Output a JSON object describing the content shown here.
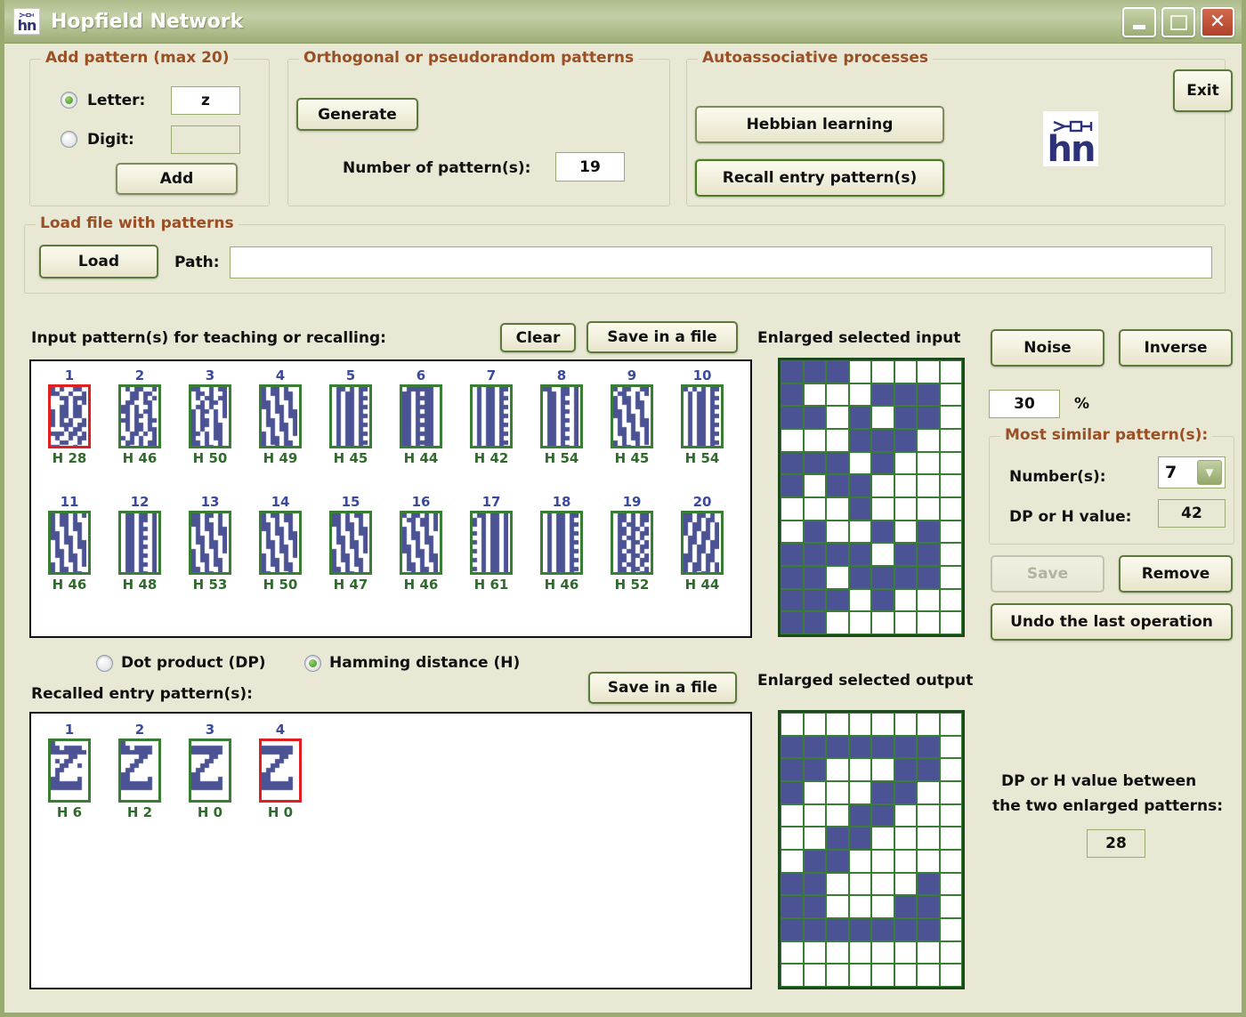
{
  "window": {
    "title": "Hopfield Network",
    "icon": "hn-app-icon",
    "buttons": {
      "minimize": "minimize-button",
      "maximize": "maximize-button",
      "close": "close-button"
    }
  },
  "add_pattern": {
    "legend": "Add pattern (max 20)",
    "letter_label": "Letter:",
    "letter_value": "z",
    "letter_selected": true,
    "digit_label": "Digit:",
    "digit_value": "",
    "digit_selected": false,
    "add_label": "Add"
  },
  "orthogonal": {
    "legend": "Orthogonal or pseudorandom patterns",
    "generate_label": "Generate",
    "number_label": "Number of pattern(s):",
    "number_value": "19"
  },
  "autoassociative": {
    "legend": "Autoassociative processes",
    "hebbian_label": "Hebbian learning",
    "recall_label": "Recall entry pattern(s)"
  },
  "exit_label": "Exit",
  "load_file": {
    "legend": "Load file with patterns",
    "load_label": "Load",
    "path_label": "Path:",
    "path_value": ""
  },
  "input_section": {
    "title": "Input pattern(s) for teaching or recalling:",
    "clear_label": "Clear",
    "save_label": "Save in a file",
    "enlarged_label": "Enlarged selected input"
  },
  "right_controls": {
    "noise_label": "Noise",
    "inverse_label": "Inverse",
    "noise_value": "30",
    "percent_label": "%",
    "similar_legend": "Most similar pattern(s):",
    "numbers_label": "Number(s):",
    "numbers_value": "7",
    "dph_label": "DP or H value:",
    "dph_value": "42",
    "save_label": "Save",
    "save_disabled": true,
    "remove_label": "Remove",
    "undo_label": "Undo the last operation"
  },
  "metric": {
    "dot_product_label": "Dot product (DP)",
    "dot_product_selected": false,
    "hamming_label": "Hamming distance (H)",
    "hamming_selected": true
  },
  "recalled_section": {
    "title": "Recalled entry pattern(s):",
    "save_label": "Save in a file",
    "enlarged_label": "Enlarged selected output"
  },
  "dph_between": {
    "line1": "DP or H value between",
    "line2": "the two enlarged patterns:",
    "value": "28"
  },
  "colors": {
    "pattern_blue": "#4b5394",
    "border_green": "#3a7d34",
    "border_selected": "#e02020",
    "legend_brown": "#9b4f24",
    "index_blue": "#3b4a9c",
    "hvalue_green": "#2f6b2c",
    "window_bg": "#e9e8d5",
    "titlebar_green": "#aebc8c"
  },
  "input_patterns": [
    {
      "index": "1",
      "h": "H 28",
      "selected": true,
      "bits": "101001101100100100110111000101010011011010110110101101101010100110111011000101101110110101001011001100101100010011011001101010001000"
    },
    {
      "index": "2",
      "h": "H 46",
      "selected": false,
      "bits": "010110010011011000110101011001101101001011010110010110101101001101011010010110110011010110101001011010110100101101011010011010110101"
    },
    {
      "index": "3",
      "h": "H 50",
      "selected": false,
      "bits": "110010110110100101011011001011010110100110110101101001011011010010110110101001101101011010010110110100101101101001011011010010110101"
    },
    {
      "index": "4",
      "h": "H 49",
      "selected": false,
      "bits": "101101001011011010010110110100101101101001011011010010110110100101101101001011011010010110110100101101101001011011010010110110100101"
    },
    {
      "index": "5",
      "h": "H 45",
      "selected": false,
      "bits": "011010110101101001011011010110100101101101011010010110110101101001011011010110100101101101011010010110110101101001011011010110100101"
    },
    {
      "index": "6",
      "h": "H 44",
      "selected": false,
      "bits": "011111101101011011011110110101101101111011010110110111101101011011011110110101101101111011010110110111101101011011011110110101101101"
    },
    {
      "index": "7",
      "h": "H 42",
      "selected": false,
      "bits": "010110110101101001011011010110100101101101011010010110110101101001011011010110100101101101011010010110110101101001011011010110100101"
    },
    {
      "index": "8",
      "h": "H 54",
      "selected": false,
      "bits": "110011010110110101101001011011010110100101101101011010010110110101101001011011010110100101101101011010010110110101101001011011010110"
    },
    {
      "index": "9",
      "h": "H 45",
      "selected": false,
      "bits": "101100110110010110110100101101101001011011010010110110100101101101001011011010010110110100101101101001011011010010110110100101101101"
    },
    {
      "index": "10",
      "h": "H 54",
      "selected": false,
      "bits": "101010110101101001011011010110100101101101011010010110110101101001011011010110100101101101011010010110110101101001011011010110100101"
    },
    {
      "index": "11",
      "h": "H 46",
      "selected": false,
      "bits": "101101011011010010110110100101101101001011011010010110110100101101101001011011010010110110100101101101001011011010010110110100101101"
    },
    {
      "index": "12",
      "h": "H 48",
      "selected": false,
      "bits": "011011010110110101101001011011010110100101101101011010010110110101101001011011010110100101101101011010010110110101101001011011010110"
    },
    {
      "index": "13",
      "h": "H 53",
      "selected": false,
      "bits": "110110101101001011011010010110110100101101101001011011010010110110100101101101001011011010010110110100101101101001011011010010110110"
    },
    {
      "index": "14",
      "h": "H 50",
      "selected": false,
      "bits": "101101101001011011010010110110100101101101001011011010010110110100101101101001011011010010110110100101101101001011011010010110110100"
    },
    {
      "index": "15",
      "h": "H 47",
      "selected": false,
      "bits": "110101101101001011011010010110110100101101101001011011010010110110100101101101001011011010010110110100101101101001011011010010110110"
    },
    {
      "index": "16",
      "h": "H 46",
      "selected": false,
      "bits": "101101010110110100101101101001011011010010110110100101101101001011011010010110110100101101101001011011010010110110100101101101001011"
    },
    {
      "index": "17",
      "h": "H 61",
      "selected": false,
      "bits": "011011011010110110101101001011011010110100101101101011010010110110101101001011011010110100101101101011010010110110101101001011011010"
    },
    {
      "index": "18",
      "h": "H 46",
      "selected": false,
      "bits": "010110110101101001011011010110100101101101011010010110110101101001011011010110100101101101011010010110110101101001011011010110100101"
    },
    {
      "index": "19",
      "h": "H 52",
      "selected": false,
      "bits": "011010110110101101011010011011010110101101011010011011010110101101011010011011010110101101011010011011010110101101011010011011010110"
    },
    {
      "index": "20",
      "h": "H 44",
      "selected": false,
      "bits": "110110101101011010110101101101011010110101101101011010110101101101011010110101101101011010110101101101011010110101101101011010110101"
    }
  ],
  "recalled_patterns": [
    {
      "index": "1",
      "h": "H 6",
      "selected": false,
      "letter": "Z",
      "noise": 6
    },
    {
      "index": "2",
      "h": "H 2",
      "selected": false,
      "letter": "Z",
      "noise": 2
    },
    {
      "index": "3",
      "h": "H 0",
      "selected": false,
      "letter": "Z",
      "noise": 0
    },
    {
      "index": "4",
      "h": "H 0",
      "selected": true,
      "letter": "Z",
      "noise": 0
    }
  ],
  "enlarged_input": {
    "cols": 8,
    "rows": 12,
    "grid": [
      [
        1,
        1,
        1,
        0,
        0,
        0,
        0,
        0
      ],
      [
        1,
        0,
        0,
        0,
        1,
        1,
        1,
        0
      ],
      [
        1,
        1,
        0,
        1,
        0,
        1,
        1,
        0
      ],
      [
        0,
        0,
        0,
        1,
        1,
        1,
        0,
        0
      ],
      [
        1,
        1,
        1,
        0,
        1,
        0,
        0,
        0
      ],
      [
        1,
        0,
        1,
        1,
        0,
        0,
        0,
        0
      ],
      [
        0,
        0,
        0,
        1,
        0,
        0,
        0,
        0
      ],
      [
        0,
        1,
        0,
        0,
        1,
        0,
        1,
        0
      ],
      [
        1,
        1,
        1,
        1,
        0,
        1,
        1,
        0
      ],
      [
        1,
        1,
        0,
        1,
        1,
        1,
        1,
        0
      ],
      [
        1,
        1,
        1,
        0,
        1,
        0,
        0,
        0
      ],
      [
        1,
        1,
        0,
        0,
        0,
        0,
        0,
        0
      ]
    ]
  },
  "enlarged_output": {
    "cols": 8,
    "rows": 12,
    "grid": [
      [
        0,
        0,
        0,
        0,
        0,
        0,
        0,
        0
      ],
      [
        1,
        1,
        1,
        1,
        1,
        1,
        1,
        0
      ],
      [
        1,
        1,
        0,
        0,
        0,
        1,
        1,
        0
      ],
      [
        1,
        0,
        0,
        0,
        1,
        1,
        0,
        0
      ],
      [
        0,
        0,
        0,
        1,
        1,
        0,
        0,
        0
      ],
      [
        0,
        0,
        1,
        1,
        0,
        0,
        0,
        0
      ],
      [
        0,
        1,
        1,
        0,
        0,
        0,
        0,
        0
      ],
      [
        1,
        1,
        0,
        0,
        0,
        0,
        1,
        0
      ],
      [
        1,
        1,
        0,
        0,
        0,
        1,
        1,
        0
      ],
      [
        1,
        1,
        1,
        1,
        1,
        1,
        1,
        0
      ],
      [
        0,
        0,
        0,
        0,
        0,
        0,
        0,
        0
      ],
      [
        0,
        0,
        0,
        0,
        0,
        0,
        0,
        0
      ]
    ]
  }
}
